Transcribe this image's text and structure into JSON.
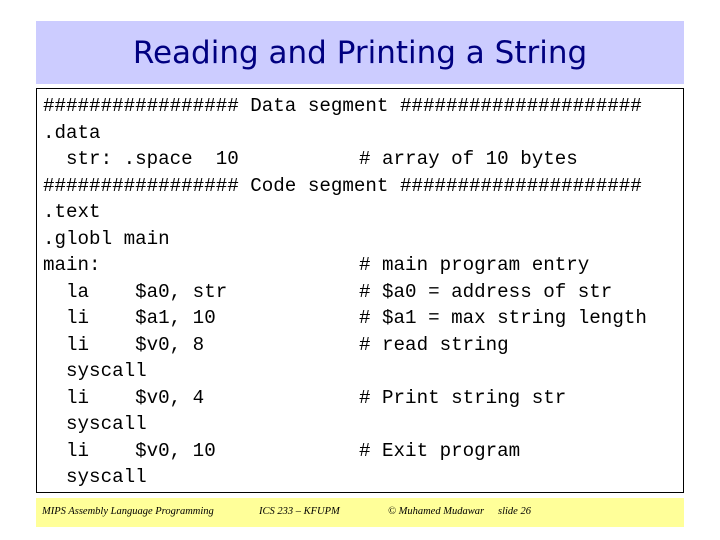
{
  "slide": {
    "title": "Reading and Printing a String",
    "colors": {
      "title_band": "#ccccff",
      "title_text": "#000080",
      "footer_band": "#ffff99"
    }
  },
  "code": {
    "lines": [
      {
        "code": "################# Data segment #####################",
        "comment": ""
      },
      {
        "code": ".data",
        "comment": ""
      },
      {
        "code": "  str: .space  10",
        "comment": "# array of 10 bytes"
      },
      {
        "code": "################# Code segment #####################",
        "comment": ""
      },
      {
        "code": ".text",
        "comment": ""
      },
      {
        "code": ".globl main",
        "comment": ""
      },
      {
        "code": "main:",
        "comment": "# main program entry"
      },
      {
        "code": "  la    $a0, str",
        "comment": "# $a0 = address of str"
      },
      {
        "code": "  li    $a1, 10",
        "comment": "# $a1 = max string length"
      },
      {
        "code": "  li    $v0, 8",
        "comment": "# read string"
      },
      {
        "code": "  syscall",
        "comment": ""
      },
      {
        "code": "  li    $v0, 4",
        "comment": "# Print string str"
      },
      {
        "code": "  syscall",
        "comment": ""
      },
      {
        "code": "  li    $v0, 10",
        "comment": "# Exit program"
      },
      {
        "code": "  syscall",
        "comment": ""
      }
    ]
  },
  "footer": {
    "course": "MIPS Assembly Language Programming",
    "institution": "ICS 233 – KFUPM",
    "author": "© Muhamed Mudawar",
    "slide_label": "slide 26"
  }
}
